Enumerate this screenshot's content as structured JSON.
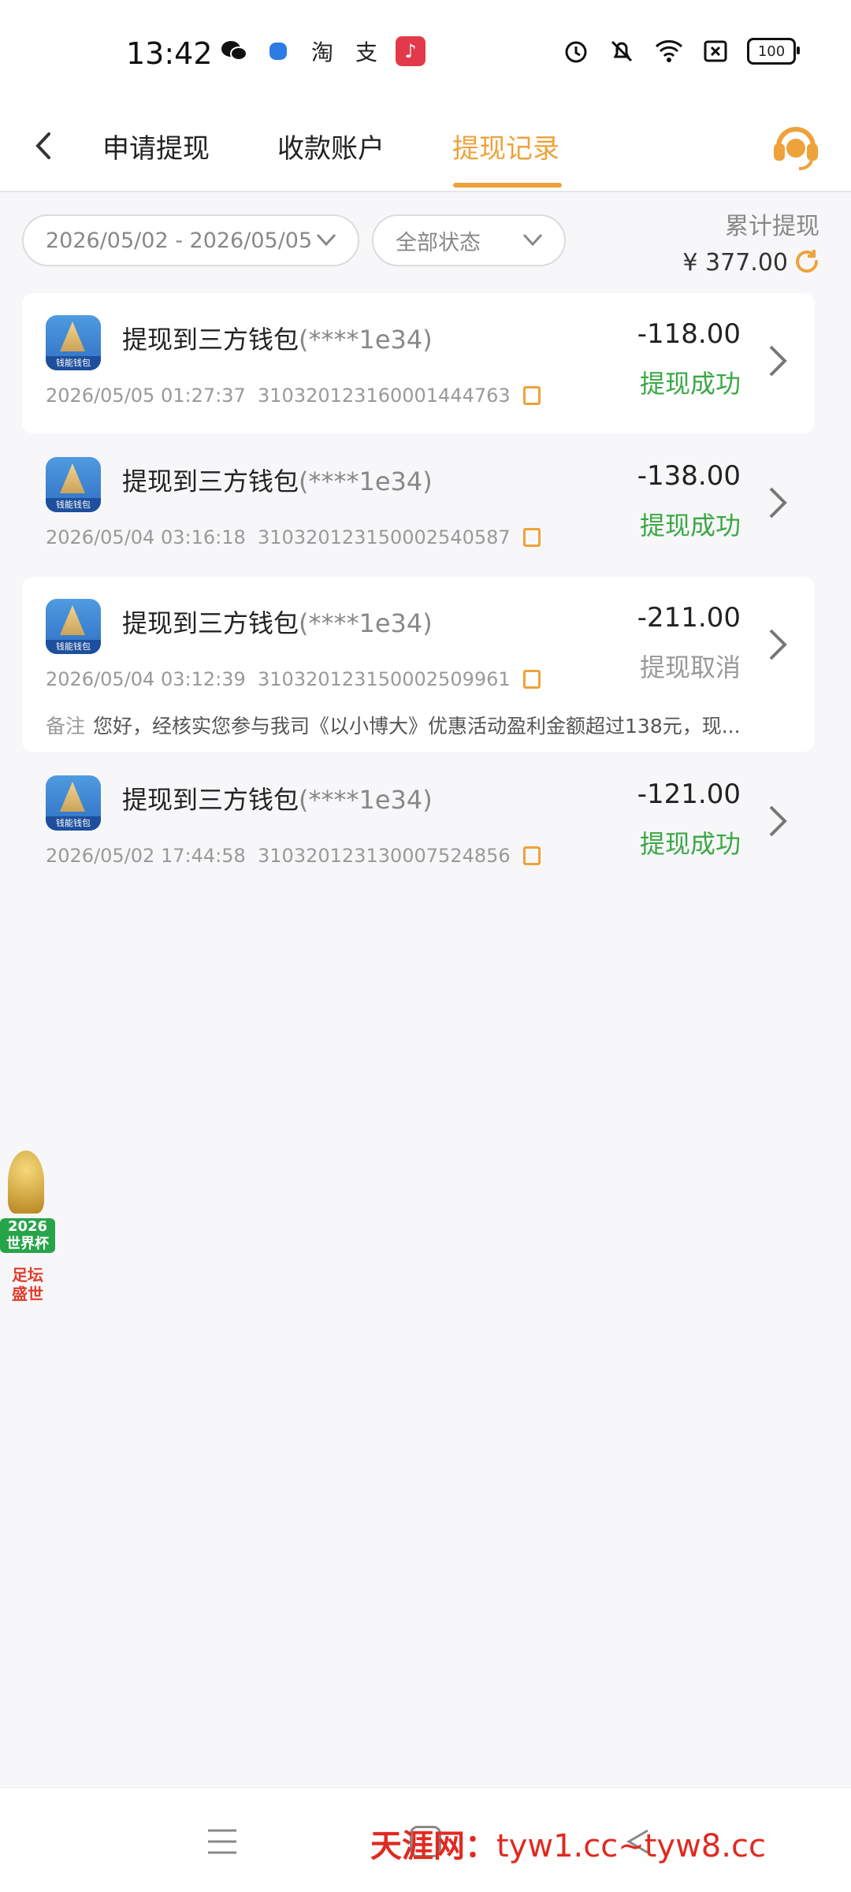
{
  "status_bar": {
    "time": "13:42",
    "app_icons": [
      "wechat-icon",
      "app-icon",
      "taobao-icon",
      "alipay-icon",
      "music-icon"
    ],
    "app_glyphs": [
      "",
      "",
      "淘",
      "支",
      "♪"
    ],
    "battery": "100"
  },
  "nav": {
    "tabs": [
      {
        "label": "申请提现"
      },
      {
        "label": "收款账户"
      },
      {
        "label": "提现记录"
      }
    ],
    "active_tab": 2,
    "accent": "#eea23b"
  },
  "filters": {
    "date_range": "2026/05/02 - 2026/05/05",
    "status": "全部状态",
    "total_label": "累计提现",
    "total_value": "¥ 377.00"
  },
  "records": [
    {
      "title": "提现到三方钱包",
      "account": "(****1e34)",
      "datetime": "2026/05/05 01:27:37",
      "order_no": "3103201231600014447​63",
      "amount": "-118.00",
      "status": "提现成功"
    },
    {
      "title": "提现到三方钱包",
      "account": "(****1e34)",
      "datetime": "2026/05/04 03:16:18",
      "order_no": "310320123150002540587",
      "amount": "-138.00",
      "status": "提现成功"
    },
    {
      "title": "提现到三方钱包",
      "account": "(****1e34)",
      "datetime": "2026/05/04 03:12:39",
      "order_no": "310320123150002509961",
      "amount": "-211.00",
      "status": "提现取消",
      "remark_label": "备注",
      "remark": "您好，经核实您参与我司《以小博大》优惠活动盈利金额超过138元，现..."
    },
    {
      "title": "提现到三方钱包",
      "account": "(****1e34)",
      "datetime": "2026/05/02 17:44:58",
      "order_no": "310320123130007524856",
      "amount": "-121.00",
      "status": "提现成功"
    }
  ],
  "logo_caption": "钱能钱包",
  "promo": {
    "line1": "2026\n世界杯",
    "line2": "足坛\n盛世"
  },
  "watermark": {
    "site": "天涯网：",
    "domains": "tyw1.cc~tyw8.cc"
  },
  "colors": {
    "success": "#3ba844",
    "muted": "#999999"
  }
}
